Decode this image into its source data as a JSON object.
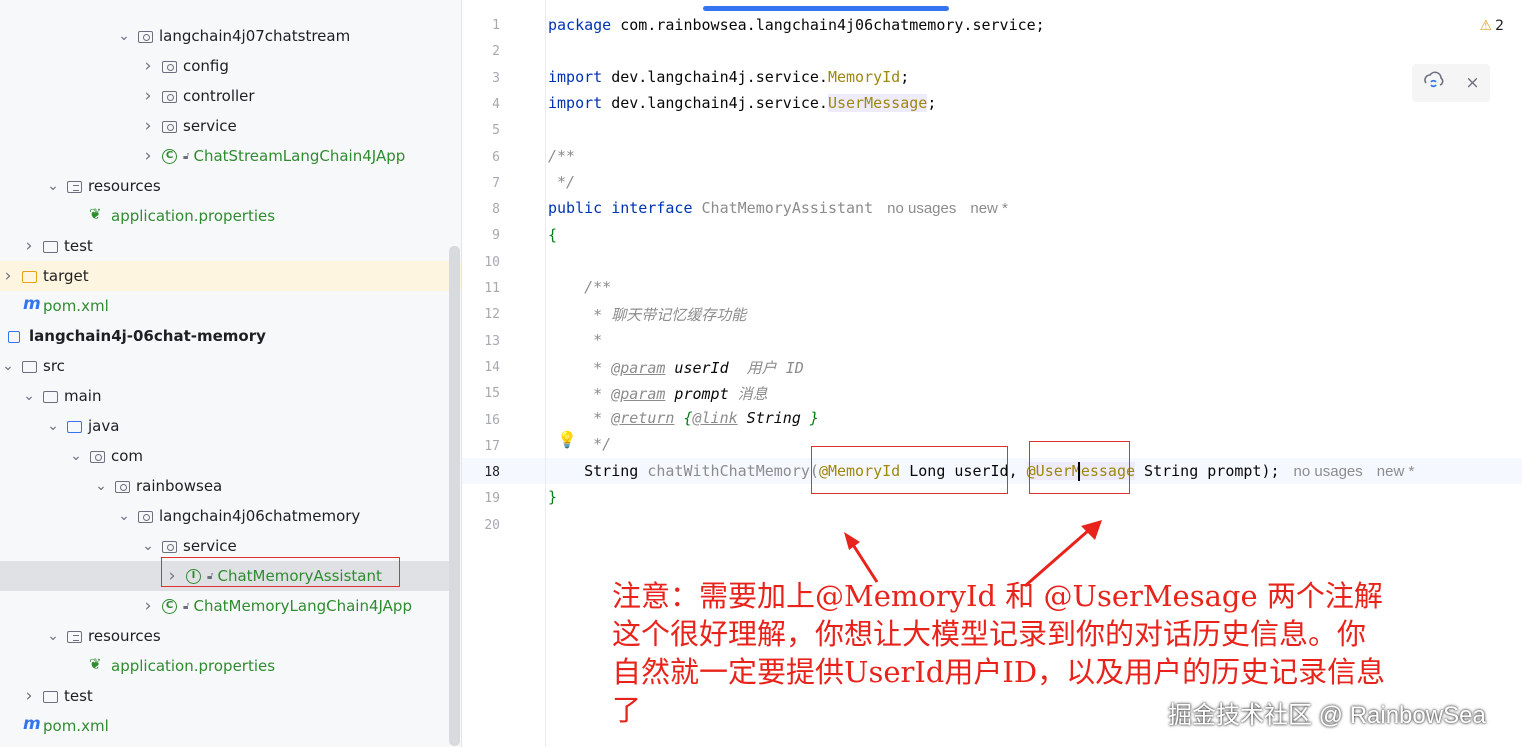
{
  "tree": {
    "items": [
      {
        "label": "langchain4j07chatstream",
        "kind": "package",
        "expanded": true
      },
      {
        "label": "config",
        "kind": "package",
        "expanded": false
      },
      {
        "label": "controller",
        "kind": "package",
        "expanded": false
      },
      {
        "label": "service",
        "kind": "package",
        "expanded": false
      },
      {
        "label": "ChatStreamLangChain4JApp",
        "kind": "spring-class",
        "expanded": false
      },
      {
        "label": "resources",
        "kind": "resources",
        "expanded": true
      },
      {
        "label": "application.properties",
        "kind": "properties"
      },
      {
        "label": "test",
        "kind": "folder",
        "expanded": false
      },
      {
        "label": "target",
        "kind": "target-folder",
        "expanded": false
      },
      {
        "label": "pom.xml",
        "kind": "maven"
      },
      {
        "label": "langchain4j-06chat-memory",
        "kind": "module"
      },
      {
        "label": "src",
        "kind": "folder",
        "expanded": true
      },
      {
        "label": "main",
        "kind": "folder",
        "expanded": true
      },
      {
        "label": "java",
        "kind": "source-folder",
        "expanded": true
      },
      {
        "label": "com",
        "kind": "package",
        "expanded": true
      },
      {
        "label": "rainbowsea",
        "kind": "package",
        "expanded": true
      },
      {
        "label": "langchain4j06chatmemory",
        "kind": "package",
        "expanded": true
      },
      {
        "label": "service",
        "kind": "package",
        "expanded": true
      },
      {
        "label": "ChatMemoryAssistant",
        "kind": "interface",
        "expanded": false,
        "selected": true
      },
      {
        "label": "ChatMemoryLangChain4JApp",
        "kind": "spring-class",
        "expanded": false
      },
      {
        "label": "resources",
        "kind": "resources",
        "expanded": true
      },
      {
        "label": "application.properties",
        "kind": "properties"
      },
      {
        "label": "test",
        "kind": "folder",
        "expanded": false
      },
      {
        "label": "pom.xml",
        "kind": "maven"
      }
    ]
  },
  "editor": {
    "problems_count": "2",
    "line_numbers": [
      "1",
      "2",
      "3",
      "4",
      "5",
      "6",
      "7",
      "8",
      "9",
      "10",
      "11",
      "12",
      "13",
      "14",
      "15",
      "16",
      "17",
      "18",
      "19",
      "20"
    ],
    "current_line": "18",
    "code": {
      "l1_kw": "package",
      "l1_rest": " com.rainbowsea.langchain4j06chatmemory.service;",
      "l3_kw": "import",
      "l3_pre": " dev.langchain4j.service.",
      "l3_ann": "MemoryId",
      "l3_end": ";",
      "l4_kw": "import",
      "l4_pre": " dev.langchain4j.service.",
      "l4_ann": "UserMessage",
      "l4_end": ";",
      "l6": "/**",
      "l7": " */",
      "l8_kw": "public interface",
      "l8_name": " ChatMemoryAssistant",
      "l8_hint1": "no usages",
      "l8_hint2": "new *",
      "l9": "{",
      "l11": "    /**",
      "l12": "     * 聊天带记忆缓存功能",
      "l13": "     *",
      "l14_star": "     * ",
      "l14_tag": "@param",
      "l14_name": " userId",
      "l14_desc": "  用户 ID",
      "l15_star": "     * ",
      "l15_tag": "@param",
      "l15_name": " prompt",
      "l15_desc": " 消息",
      "l16_star": "     * ",
      "l16_tag": "@return",
      "l16_open": " {",
      "l16_link": "@link",
      "l16_type": " String",
      "l16_close": " }",
      "l17": "     */",
      "l18_type": "    String",
      "l18_method": " chatWithChatMemory(",
      "l18_ann1": "@MemoryId",
      "l18_p1": " Long userId, ",
      "l18_ann2": "@UserMessage",
      "l18_p2": " String prompt);",
      "l18_hint1": "no usages",
      "l18_hint2": "new *",
      "l19": "}"
    }
  },
  "annotation": {
    "line1": "注意：需要加上@MemoryId 和 @UserMesage 两个注解",
    "line2": "这个很好理解，你想让大模型记录到你的对话历史信息。你",
    "line3": "自然就一定要提供UserId用户ID，以及用户的历史记录信息",
    "line4": "了"
  },
  "watermark": "掘金技术社区 @ RainbowSea",
  "icons": [
    "chevron-right-icon",
    "chevron-down-icon",
    "package-icon",
    "folder-icon",
    "spring-icon",
    "properties-leaf-icon",
    "maven-icon",
    "interface-icon",
    "lock-icon",
    "warning-icon",
    "lightbulb-icon",
    "ai-assist-icon",
    "close-icon"
  ],
  "colors": {
    "annotation": "#e8231b",
    "keyword": "#0033b3",
    "annotation_code": "#9e880d",
    "tree_green": "#2f8c2f"
  }
}
